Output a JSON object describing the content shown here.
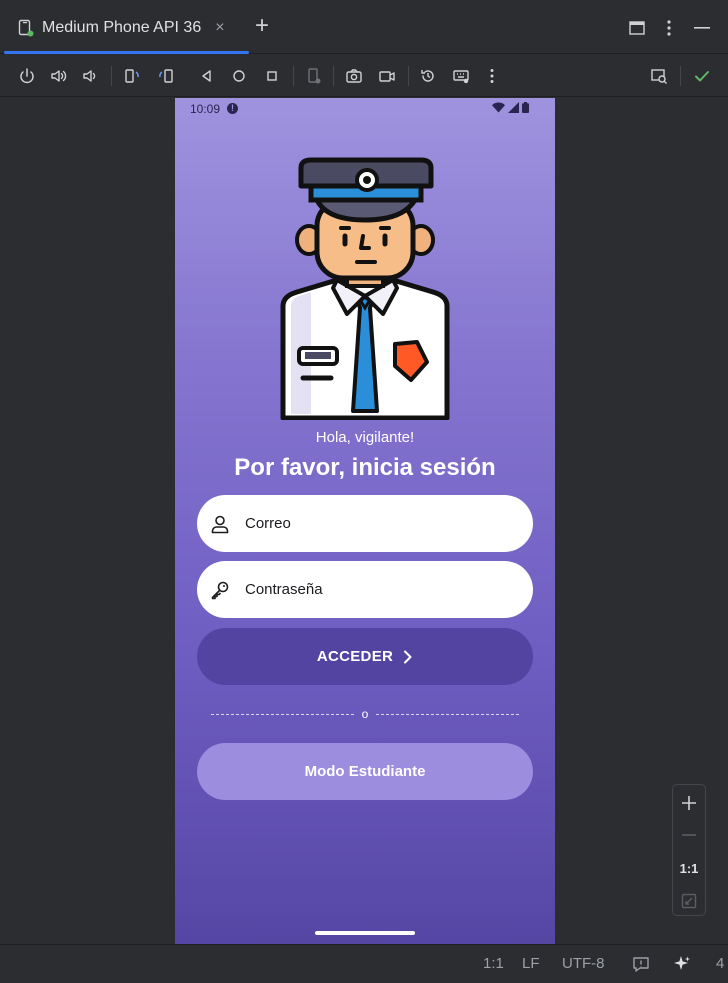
{
  "ide": {
    "tab_title": "Medium Phone API 36",
    "tab_close": "×",
    "tab_add": "+",
    "zoom_reset_label": "1:1",
    "status": {
      "zoom": "1:1",
      "line_sep": "LF",
      "encoding": "UTF-8",
      "extra": "4"
    }
  },
  "phone": {
    "time": "10:09",
    "status_alert": "!",
    "greeting": "Hola, vigilante!",
    "headline": "Por favor, inicia sesión",
    "email_placeholder": "Correo",
    "password_placeholder": "Contraseña",
    "login_label": "ACCEDER",
    "divider_text": "o",
    "student_mode_label": "Modo Estudiante"
  },
  "colors": {
    "accent": "#3574f0",
    "primary_button": "#5444a2",
    "secondary_button": "#9c8ddf",
    "gradient_top": "#9f93de",
    "gradient_bottom": "#5646a4",
    "check": "#5fb865"
  }
}
